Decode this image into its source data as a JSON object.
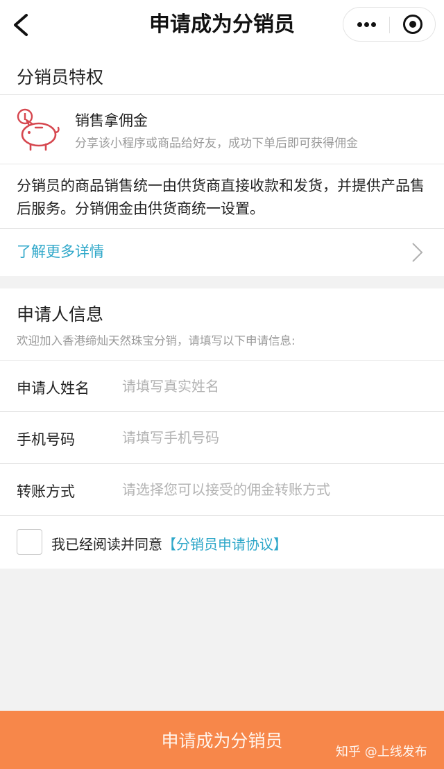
{
  "nav": {
    "title": "申请成为分销员"
  },
  "privileges": {
    "heading": "分销员特权",
    "feature_title": "销售拿佣金",
    "feature_desc": "分享该小程序或商品给好友，成功下单后即可获得佣金",
    "paragraph": "分销员的商品销售统一由供货商直接收款和发货，并提供产品售后服务。分销佣金由供货商统一设置。",
    "more_link": "了解更多详情"
  },
  "applicant": {
    "heading": "申请人信息",
    "subtitle": "欢迎加入香港缔灿天然珠宝分销，请填写以下申请信息:",
    "fields": [
      {
        "label": "申请人姓名",
        "placeholder": "请填写真实姓名"
      },
      {
        "label": "手机号码",
        "placeholder": "请填写手机号码"
      },
      {
        "label": "转账方式",
        "placeholder": "请选择您可以接受的佣金转账方式"
      }
    ],
    "agree_text": "我已经阅读并同意",
    "agree_link": "【分销员申请协议】"
  },
  "submit_label": "申请成为分销员",
  "watermark": "知乎 @上线发布",
  "colors": {
    "accent": "#f7874a",
    "link": "#2ea7c9",
    "icon": "#d6474f"
  },
  "icons": [
    "back-arrow-icon",
    "more-dots-icon",
    "close-circle-icon",
    "piggy-bank-icon",
    "chevron-right-icon"
  ]
}
